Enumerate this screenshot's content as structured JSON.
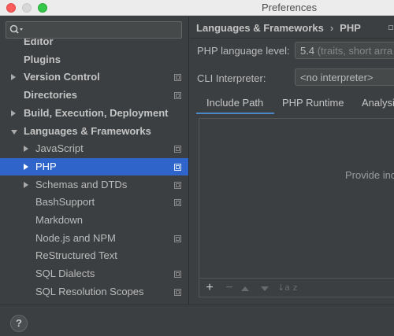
{
  "window": {
    "title": "Preferences"
  },
  "search": {
    "placeholder": ""
  },
  "sidebar": {
    "items": [
      {
        "label": "Editor",
        "level": 0,
        "expander": "none",
        "bold": true,
        "copy": false,
        "selected": false
      },
      {
        "label": "Plugins",
        "level": 0,
        "expander": "none",
        "bold": true,
        "copy": false,
        "selected": false
      },
      {
        "label": "Version Control",
        "level": 0,
        "expander": "right",
        "bold": true,
        "copy": true,
        "selected": false
      },
      {
        "label": "Directories",
        "level": 0,
        "expander": "none",
        "bold": true,
        "copy": true,
        "selected": false
      },
      {
        "label": "Build, Execution, Deployment",
        "level": 0,
        "expander": "right",
        "bold": true,
        "copy": false,
        "selected": false
      },
      {
        "label": "Languages & Frameworks",
        "level": 0,
        "expander": "down",
        "bold": true,
        "copy": false,
        "selected": false
      },
      {
        "label": "JavaScript",
        "level": 1,
        "expander": "right",
        "bold": false,
        "copy": true,
        "selected": false
      },
      {
        "label": "PHP",
        "level": 1,
        "expander": "right",
        "bold": false,
        "copy": true,
        "selected": true
      },
      {
        "label": "Schemas and DTDs",
        "level": 1,
        "expander": "right",
        "bold": false,
        "copy": true,
        "selected": false
      },
      {
        "label": "BashSupport",
        "level": 1,
        "expander": "none",
        "bold": false,
        "copy": true,
        "selected": false
      },
      {
        "label": "Markdown",
        "level": 1,
        "expander": "none",
        "bold": false,
        "copy": false,
        "selected": false
      },
      {
        "label": "Node.js and NPM",
        "level": 1,
        "expander": "none",
        "bold": false,
        "copy": true,
        "selected": false
      },
      {
        "label": "ReStructured Text",
        "level": 1,
        "expander": "none",
        "bold": false,
        "copy": false,
        "selected": false
      },
      {
        "label": "SQL Dialects",
        "level": 1,
        "expander": "none",
        "bold": false,
        "copy": true,
        "selected": false
      },
      {
        "label": "SQL Resolution Scopes",
        "level": 1,
        "expander": "none",
        "bold": false,
        "copy": true,
        "selected": false
      }
    ]
  },
  "content": {
    "breadcrumb": {
      "parent": "Languages & Frameworks",
      "separator": "›",
      "current": "PHP"
    },
    "php_language_level": {
      "label": "PHP language level:",
      "value": "5.4",
      "hint": " (traits, short arra"
    },
    "cli_interpreter": {
      "label": "CLI Interpreter:",
      "value": "<no interpreter>"
    },
    "tabs": [
      "Include Path",
      "PHP Runtime",
      "Analysis"
    ],
    "panel": {
      "empty_text": "Provide inc"
    },
    "toolbar": {
      "add": "+",
      "remove": "−",
      "sort": "↓a z"
    }
  },
  "bottom": {
    "help": "?"
  },
  "colors": {
    "selection": "#2f65ca",
    "tab_underline": "#4a88c7",
    "background": "#3c3f41"
  }
}
